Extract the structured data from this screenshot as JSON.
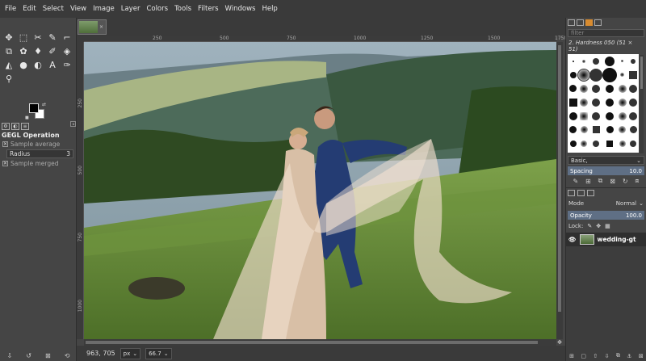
{
  "menubar": {
    "items": [
      "File",
      "Edit",
      "Select",
      "View",
      "Image",
      "Layer",
      "Colors",
      "Tools",
      "Filters",
      "Windows",
      "Help"
    ]
  },
  "toolbox": {
    "tools": [
      {
        "icon": "move-icon",
        "glyph": "✥"
      },
      {
        "icon": "rect-select-icon",
        "glyph": "⬚"
      },
      {
        "icon": "free-select-icon",
        "glyph": "✂"
      },
      {
        "icon": "fuzzy-select-icon",
        "glyph": "✎"
      },
      {
        "icon": "crop-icon",
        "glyph": "⌐"
      },
      {
        "icon": "unified-transform-icon",
        "glyph": "⧉"
      },
      {
        "icon": "warp-icon",
        "glyph": "✿"
      },
      {
        "icon": "clone-icon",
        "glyph": "♦"
      },
      {
        "icon": "paintbrush-icon",
        "glyph": "✐"
      },
      {
        "icon": "eraser-icon",
        "glyph": "◈"
      },
      {
        "icon": "bucket-fill-icon",
        "glyph": "◭"
      },
      {
        "icon": "smudge-icon",
        "glyph": "●"
      },
      {
        "icon": "dodge-icon",
        "glyph": "◐"
      },
      {
        "icon": "text-icon",
        "glyph": "A"
      },
      {
        "icon": "color-picker-icon",
        "glyph": "✑"
      },
      {
        "icon": "zoom-icon",
        "glyph": "⚲"
      }
    ],
    "colors": {
      "foreground": "#000000",
      "background": "#ffffff"
    }
  },
  "tool_options": {
    "title": "GEGL Operation",
    "sample_average": "Sample average",
    "radius_label": "Radius",
    "radius_value": "3",
    "sample_merged": "Sample merged"
  },
  "image_tab": {
    "close_glyph": "×"
  },
  "rulers": {
    "top_ticks": [
      "250",
      "500",
      "750",
      "1000",
      "1250",
      "1500",
      "1750"
    ],
    "left_ticks": [
      "250",
      "500",
      "750",
      "1000"
    ]
  },
  "statusbar": {
    "coords": "963, 705",
    "unit": "px",
    "zoom": "66.7"
  },
  "dock": {
    "filter_placeholder": "filter",
    "brush_name": "2. Hardness 050 (51 × 51)",
    "brush_preset": "Basic,",
    "spacing_label": "Spacing",
    "spacing_value": "10.0",
    "mode_label": "Mode",
    "mode_value": "Normal",
    "opacity_label": "Opacity",
    "opacity_value": "100.0",
    "lock_label": "Lock:",
    "layer_name": "wedding-gt"
  },
  "colors": {
    "accent_blue": "#5f6f85",
    "brush_tab_orange": "#d98c30"
  }
}
